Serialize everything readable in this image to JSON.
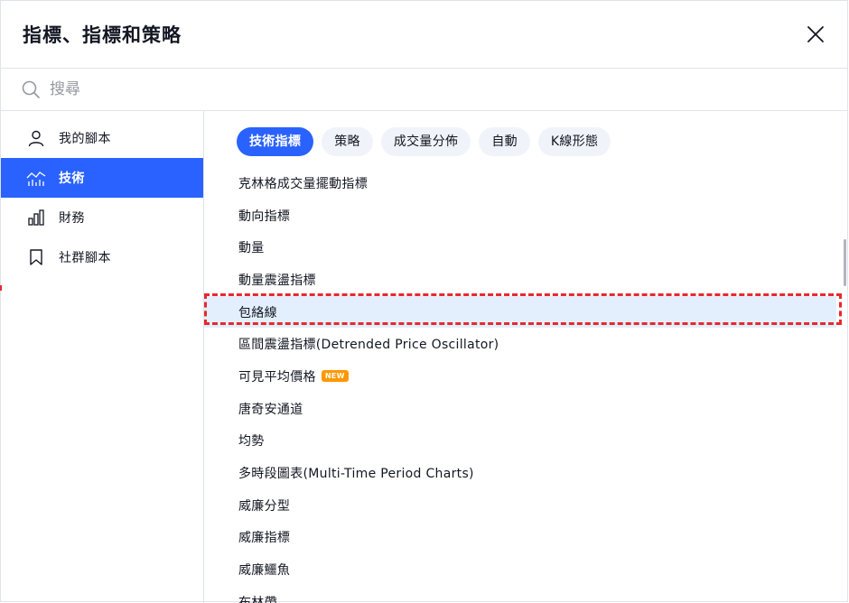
{
  "header": {
    "title": "指標、指標和策略"
  },
  "search": {
    "placeholder": "搜尋"
  },
  "sidebar": {
    "items": [
      {
        "label": "我的腳本",
        "icon": "user-icon"
      },
      {
        "label": "技術",
        "icon": "chart-line-icon",
        "active": true
      },
      {
        "label": "財務",
        "icon": "bar-chart-icon"
      },
      {
        "label": "社群腳本",
        "icon": "bookmark-icon"
      }
    ]
  },
  "tabs": [
    {
      "label": "技術指標",
      "active": true
    },
    {
      "label": "策略"
    },
    {
      "label": "成交量分佈"
    },
    {
      "label": "自動"
    },
    {
      "label": "K線形態"
    }
  ],
  "list": {
    "items": [
      {
        "label": "克林格成交量擺動指標"
      },
      {
        "label": "動向指標"
      },
      {
        "label": "動量"
      },
      {
        "label": "動量震盪指標"
      },
      {
        "label": "包絡線",
        "highlighted": true
      },
      {
        "label": "區間震盪指標(Detrended Price Oscillator)"
      },
      {
        "label": "可見平均價格",
        "badge": "NEW"
      },
      {
        "label": "唐奇安通道"
      },
      {
        "label": "均勢"
      },
      {
        "label": "多時段圖表(Multi-Time Period Charts)"
      },
      {
        "label": "威廉分型"
      },
      {
        "label": "威廉指標"
      },
      {
        "label": "威廉鱷魚"
      },
      {
        "label": "布林帶"
      }
    ]
  },
  "colors": {
    "accent": "#2962ff",
    "highlight_border": "#e8282c",
    "badge": "#ff9800"
  }
}
